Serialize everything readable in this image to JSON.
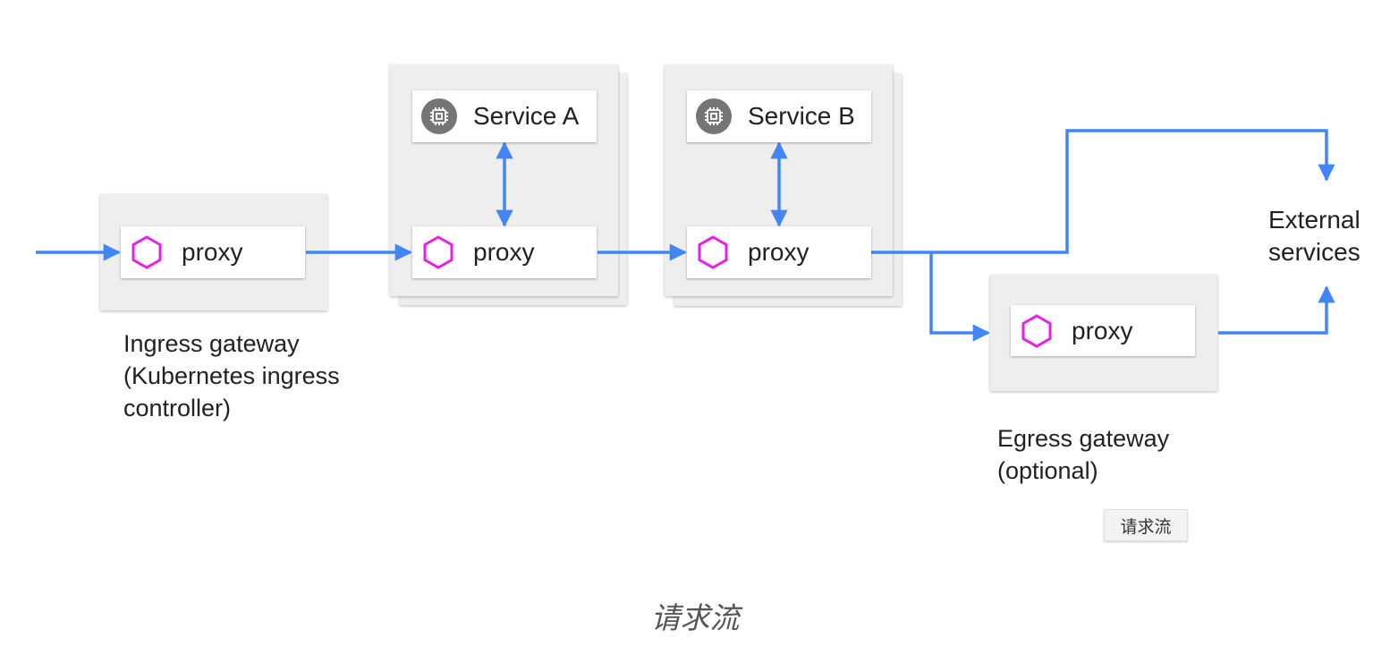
{
  "diagram": {
    "nodes": {
      "ingress_proxy": {
        "label": "proxy"
      },
      "service_a": {
        "label": "Service A"
      },
      "service_a_proxy": {
        "label": "proxy"
      },
      "service_b": {
        "label": "Service B"
      },
      "service_b_proxy": {
        "label": "proxy"
      },
      "egress_proxy": {
        "label": "proxy"
      },
      "external_services": {
        "label_line1": "External",
        "label_line2": "services"
      }
    },
    "groups": {
      "ingress": {
        "line1": "Ingress gateway",
        "line2": "(Kubernetes ingress",
        "line3": "controller)"
      },
      "egress": {
        "line1": "Egress gateway",
        "line2": "(optional)"
      }
    },
    "tag_label": "请求流",
    "caption": "请求流",
    "edges": [
      {
        "from": "client",
        "to": "ingress_proxy",
        "direction": "forward"
      },
      {
        "from": "ingress_proxy",
        "to": "service_a_proxy",
        "direction": "forward"
      },
      {
        "from": "service_a",
        "to": "service_a_proxy",
        "direction": "bidirectional"
      },
      {
        "from": "service_a_proxy",
        "to": "service_b_proxy",
        "direction": "forward"
      },
      {
        "from": "service_b",
        "to": "service_b_proxy",
        "direction": "bidirectional"
      },
      {
        "from": "service_b_proxy",
        "to": "external_services",
        "direction": "forward"
      },
      {
        "from": "service_b_proxy",
        "to": "egress_proxy",
        "direction": "forward"
      },
      {
        "from": "egress_proxy",
        "to": "external_services",
        "direction": "forward"
      }
    ],
    "colors": {
      "edge": "#4285f4",
      "proxy_icon": "#e91ee8",
      "chip_icon": "#757575",
      "panel": "#eeeeee"
    },
    "icons": {
      "proxy": "hexagon-icon",
      "service": "chip-icon"
    }
  }
}
